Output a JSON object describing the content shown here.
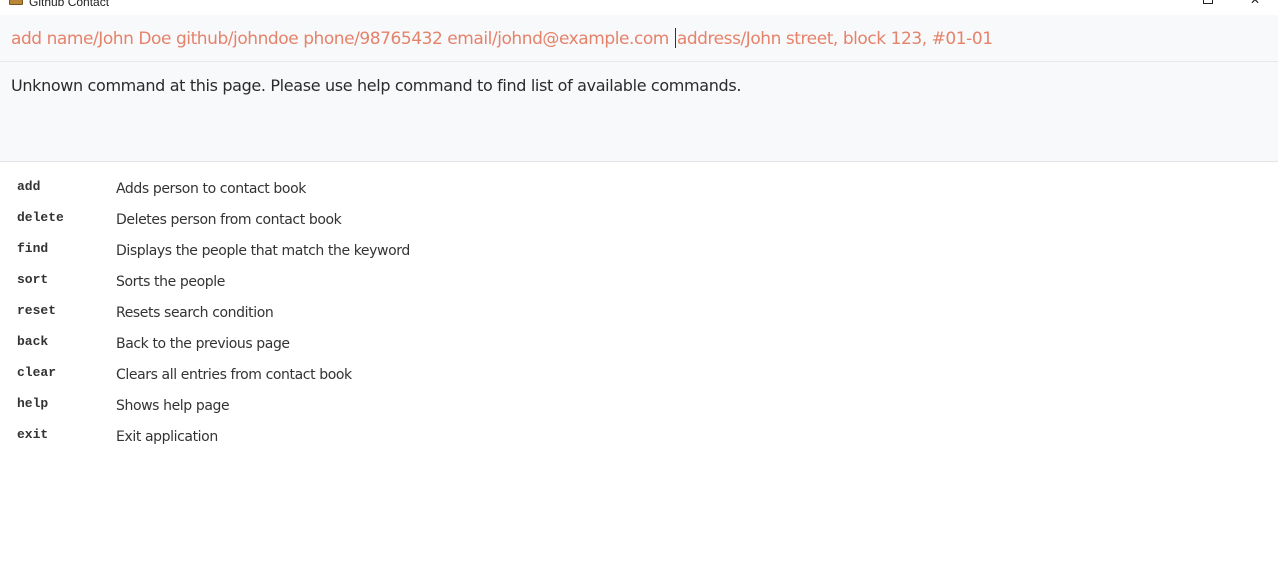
{
  "window": {
    "title": "Github Contact",
    "maximize_glyph": "",
    "close_glyph": "✕"
  },
  "command_box": {
    "value_before_caret": "add name/John Doe github/johndoe phone/98765432 email/johnd@example.com ",
    "value_after_caret": "address/John street, block 123, #01-01",
    "text_color": "#e5826a"
  },
  "result": {
    "message": "Unknown command at this page. Please use help command to find list of available commands."
  },
  "help": {
    "commands": [
      {
        "name": "add",
        "description": "Adds person to contact book"
      },
      {
        "name": "delete",
        "description": "Deletes person from contact book"
      },
      {
        "name": "find",
        "description": "Displays the people that match the keyword"
      },
      {
        "name": "sort",
        "description": "Sorts the people"
      },
      {
        "name": "reset",
        "description": "Resets search condition"
      },
      {
        "name": "back",
        "description": "Back to the previous page"
      },
      {
        "name": "clear",
        "description": "Clears all entries from contact book"
      },
      {
        "name": "help",
        "description": "Shows help page"
      },
      {
        "name": "exit",
        "description": "Exit application"
      }
    ]
  }
}
